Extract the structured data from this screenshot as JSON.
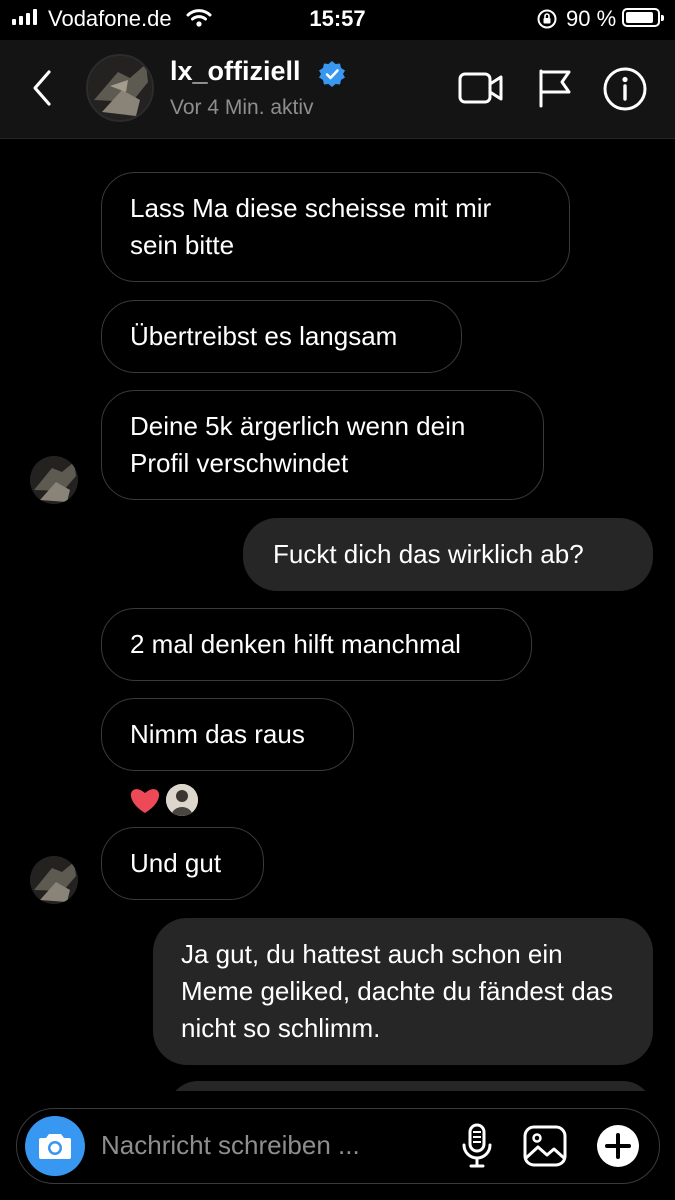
{
  "status_bar": {
    "carrier": "Vodafone.de",
    "time": "15:57",
    "battery_text": "90 %",
    "battery_level": 0.9,
    "icons": [
      "signal-icon",
      "wifi-icon",
      "rotation-lock-icon",
      "battery-icon"
    ]
  },
  "header": {
    "username": "lx_offiziell",
    "verified": true,
    "activity": "Vor 4 Min. aktiv",
    "icons": [
      "back-icon",
      "video-call-icon",
      "flag-icon",
      "info-icon"
    ]
  },
  "messages": [
    {
      "side": "received",
      "text": "Lass Ma diese scheisse mit mir sein bitte"
    },
    {
      "side": "received",
      "text": "Übertreibst es langsam"
    },
    {
      "side": "received",
      "text": "Deine 5k ärgerlich wenn dein Profil verschwindet"
    },
    {
      "side": "sent",
      "text": "Fuckt dich das wirklich ab?"
    },
    {
      "side": "received",
      "text": "2 mal denken hilft manchmal"
    },
    {
      "side": "received",
      "text": "Nimm das raus",
      "reaction": "heart"
    },
    {
      "side": "received",
      "text": "Und gut"
    },
    {
      "side": "sent",
      "text": "Ja gut, du hattest auch schon ein Meme geliked, dachte du fändest das nicht so schlimm."
    }
  ],
  "composer": {
    "placeholder": "Nachricht schreiben ...",
    "value": "",
    "icons": [
      "camera-icon",
      "microphone-icon",
      "gallery-icon",
      "plus-icon"
    ]
  },
  "colors": {
    "background": "#000000",
    "header_background": "#141414",
    "sent_bubble": "#262626",
    "received_border": "#3a3a3a",
    "muted_text": "#8e8e8e",
    "verified_badge": "#3897f0",
    "camera_button": "#3897f0",
    "heart": "#ed4956"
  }
}
